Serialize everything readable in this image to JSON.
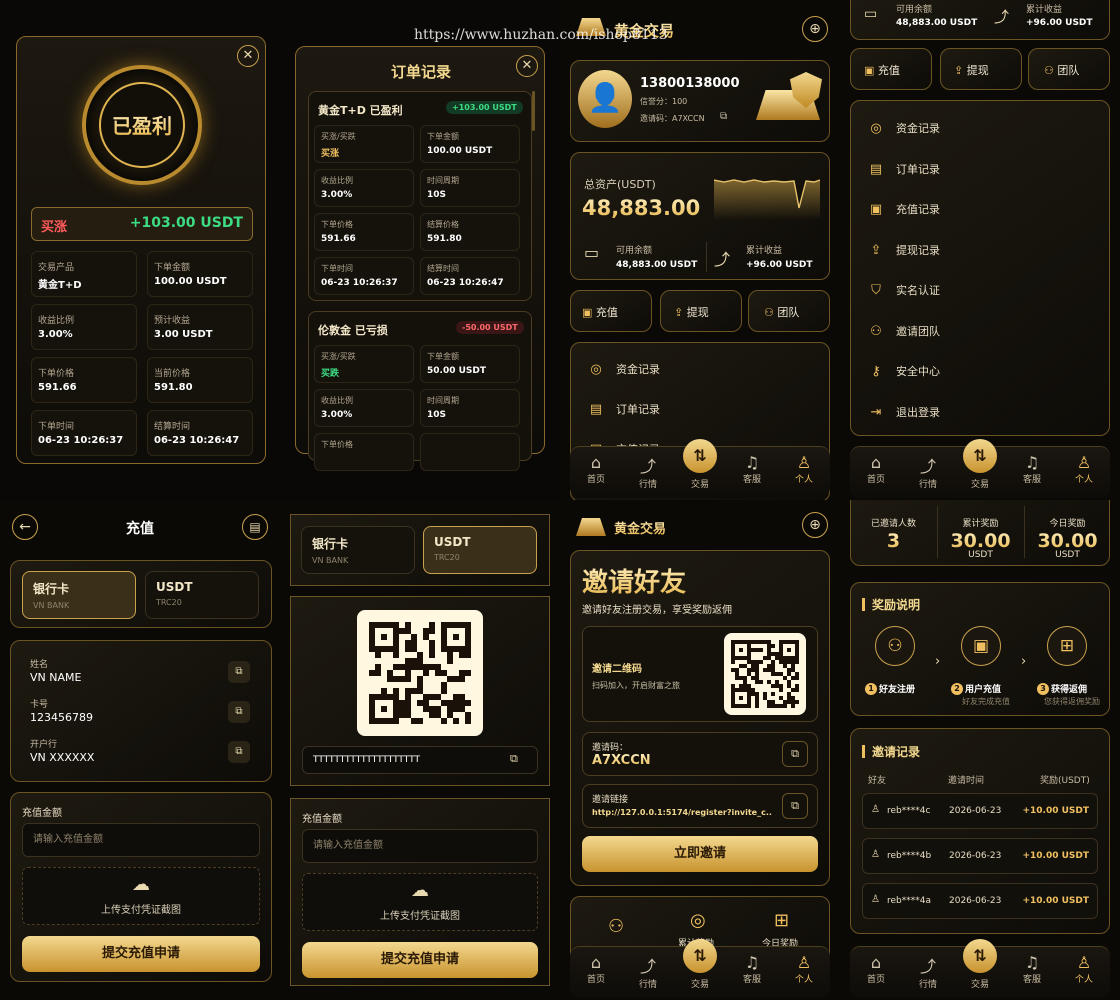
{
  "watermark": "https://www.huzhan.com/ishop8113",
  "p1": {
    "badge": "已盈利",
    "direction": "买涨",
    "profit": "+103.00 USDT",
    "cells": [
      {
        "k": "交易产品",
        "v": "黄金T+D"
      },
      {
        "k": "下单金额",
        "v": "100.00 USDT"
      },
      {
        "k": "收益比例",
        "v": "3.00%"
      },
      {
        "k": "预计收益",
        "v": "3.00 USDT"
      },
      {
        "k": "下单价格",
        "v": "591.66"
      },
      {
        "k": "当前价格",
        "v": "591.80"
      },
      {
        "k": "下单时间",
        "v": "06-23 10:26:37"
      },
      {
        "k": "结算时间",
        "v": "06-23 10:26:47"
      }
    ]
  },
  "p2": {
    "title": "订单记录",
    "order1": {
      "name": "黄金T+D 已盈利",
      "tag": "+103.00 USDT",
      "cells": [
        {
          "k": "买涨/买跌",
          "v": "买涨"
        },
        {
          "k": "下单金额",
          "v": "100.00 USDT"
        },
        {
          "k": "收益比例",
          "v": "3.00%"
        },
        {
          "k": "时间周期",
          "v": "10S"
        },
        {
          "k": "下单价格",
          "v": "591.66"
        },
        {
          "k": "结算价格",
          "v": "591.80"
        },
        {
          "k": "下单时间",
          "v": "06-23 10:26:37"
        },
        {
          "k": "结算时间",
          "v": "06-23 10:26:47"
        }
      ]
    },
    "order2": {
      "name": "伦敦金 已亏损",
      "tag": "-50.00 USDT",
      "cells": [
        {
          "k": "买涨/买跌",
          "v": "买跌"
        },
        {
          "k": "下单金额",
          "v": "50.00 USDT"
        },
        {
          "k": "收益比例",
          "v": "3.00%"
        },
        {
          "k": "时间周期",
          "v": "10S"
        },
        {
          "k": "下单价格",
          "v": ""
        },
        {
          "k": "",
          "v": ""
        }
      ]
    }
  },
  "p3": {
    "brand": "黄金交易",
    "phone": "13800138000",
    "credit": "信誉分：100",
    "invite": "邀请码：A7XCCN",
    "total_label": "总资产(USDT)",
    "total_value": "48,883.00",
    "avail_label": "可用余额",
    "avail_value": "48,883.00 USDT",
    "income_label": "累计收益",
    "income_value": "+96.00 USDT",
    "btn_recharge": "充值",
    "btn_withdraw": "提现",
    "btn_team": "团队",
    "menu": [
      "资金记录",
      "订单记录",
      "充值记录"
    ]
  },
  "p4": {
    "avail_label": "可用余额",
    "avail_value": "48,883.00 USDT",
    "income_label": "累计收益",
    "income_value": "+96.00 USDT",
    "btn_recharge": "充值",
    "btn_withdraw": "提现",
    "btn_team": "团队",
    "menu": [
      "资金记录",
      "订单记录",
      "充值记录",
      "提现记录",
      "实名认证",
      "邀请团队",
      "安全中心",
      "退出登录"
    ]
  },
  "tabs": [
    "首页",
    "行情",
    "交易",
    "客服",
    "个人"
  ],
  "p5": {
    "title": "充值",
    "bank_label": "银行卡",
    "bank_sub": "VN BANK",
    "usdt_label": "USDT",
    "usdt_sub": "TRC20",
    "name_k": "姓名",
    "name_v": "VN NAME",
    "card_k": "卡号",
    "card_v": "123456789",
    "branch_k": "开户行",
    "branch_v": "VN XXXXXX",
    "amount_label": "充值金额",
    "amount_ph": "请输入充值金额",
    "upload": "上传支付凭证截图",
    "submit": "提交充值申请"
  },
  "p6": {
    "bank_label": "银行卡",
    "bank_sub": "VN BANK",
    "usdt_label": "USDT",
    "usdt_sub": "TRC20",
    "address": "TTTTTTTTTTTTTTTTTTTT",
    "amount_label": "充值金额",
    "amount_ph": "请输入充值金额",
    "upload": "上传支付凭证截图",
    "submit": "提交充值申请"
  },
  "p7": {
    "brand": "黄金交易",
    "title": "邀请好友",
    "subtitle": "邀请好友注册交易，享受奖励返佣",
    "qr_title": "邀请二维码",
    "qr_sub": "扫码加入，开启财富之旅",
    "code_label": "邀请码：",
    "code": "A7XCCN",
    "link_label": "邀请链接",
    "link": "http://127.0.0.1:5174/register?invite_c...",
    "invite_btn": "立即邀请",
    "stats": [
      "累计奖励",
      "今日奖励"
    ]
  },
  "p8": {
    "stats": [
      {
        "label": "已邀请人数",
        "value": "3",
        "unit": ""
      },
      {
        "label": "累计奖励",
        "value": "30.00",
        "unit": "USDT"
      },
      {
        "label": "今日奖励",
        "value": "30.00",
        "unit": "USDT"
      }
    ],
    "rules_title": "奖励说明",
    "steps": [
      {
        "n": "1",
        "t": "好友注册",
        "s": ""
      },
      {
        "n": "2",
        "t": "用户充值",
        "s": "好友完成充值"
      },
      {
        "n": "3",
        "t": "获得返佣",
        "s": "您获得返佣奖励"
      }
    ],
    "records_title": "邀请记录",
    "cols": [
      "好友",
      "邀请时间",
      "奖励(USDT)"
    ],
    "rows": [
      {
        "u": "reb****4c",
        "d": "2026-06-23",
        "r": "+10.00 USDT"
      },
      {
        "u": "reb****4b",
        "d": "2026-06-23",
        "r": "+10.00 USDT"
      },
      {
        "u": "reb****4a",
        "d": "2026-06-23",
        "r": "+10.00 USDT"
      }
    ]
  }
}
